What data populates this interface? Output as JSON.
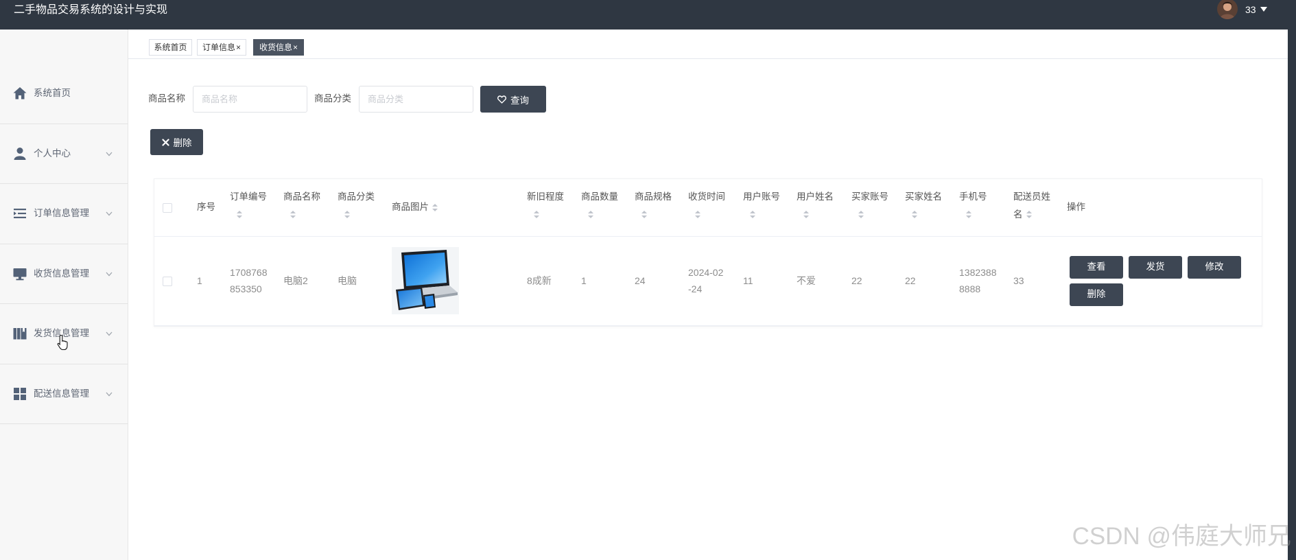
{
  "app": {
    "title": "二手物品交易系统的设计与实现"
  },
  "user": {
    "name": "33",
    "avatar_icon": "user-avatar-icon",
    "menu_icon": "caret-down-icon"
  },
  "colors": {
    "header_bg": "#2f3742",
    "sidebar_bg": "#f7f7f7",
    "button_bg": "#3d4653",
    "active_tab_bg": "#4a5360",
    "icon_color": "#536278"
  },
  "sidebar": {
    "items": [
      {
        "label": "系统首页",
        "icon": "home-icon",
        "expandable": false
      },
      {
        "label": "个人中心",
        "icon": "user-icon",
        "expandable": true
      },
      {
        "label": "订单信息管理",
        "icon": "list-icon",
        "expandable": true
      },
      {
        "label": "收货信息管理",
        "icon": "monitor-icon",
        "expandable": true
      },
      {
        "label": "发货信息管理",
        "icon": "book-icon",
        "expandable": true
      },
      {
        "label": "配送信息管理",
        "icon": "grid-icon",
        "expandable": true
      }
    ]
  },
  "tabs": {
    "close_glyph": "×",
    "active_index": 2,
    "items": [
      {
        "label": "系统首页",
        "closable": false
      },
      {
        "label": "订单信息",
        "closable": true
      },
      {
        "label": "收货信息",
        "closable": true
      }
    ]
  },
  "search": {
    "name_label": "商品名称",
    "name_placeholder": "商品名称",
    "name_value": "",
    "category_label": "商品分类",
    "category_placeholder": "商品分类",
    "category_value": "",
    "query_label": "查询",
    "query_icon": "heart-icon"
  },
  "toolbar": {
    "delete_label": "删除",
    "delete_icon": "close-icon"
  },
  "table": {
    "columns": [
      "序号",
      "订单编号",
      "商品名称",
      "商品分类",
      "商品图片",
      "新旧程度",
      "商品数量",
      "商品规格",
      "收货时间",
      "用户账号",
      "用户姓名",
      "买家账号",
      "买家姓名",
      "手机号",
      "配送员姓名",
      "操作"
    ],
    "rows": [
      {
        "index": "1",
        "order_no": "1708768853350",
        "product_name": "电脑2",
        "product_category": "电脑",
        "product_image": "laptop-icon",
        "condition": "8成新",
        "quantity": "1",
        "spec": "24",
        "received_time": "2024-02-24",
        "user_account": "11",
        "user_name": "不爱",
        "buyer_account": "22",
        "buyer_name": "22",
        "phone": "13823888888",
        "courier_name": "33"
      }
    ],
    "row_actions": [
      "查看",
      "发货",
      "修改",
      "删除"
    ]
  },
  "watermark": "CSDN @伟庭大师兄"
}
